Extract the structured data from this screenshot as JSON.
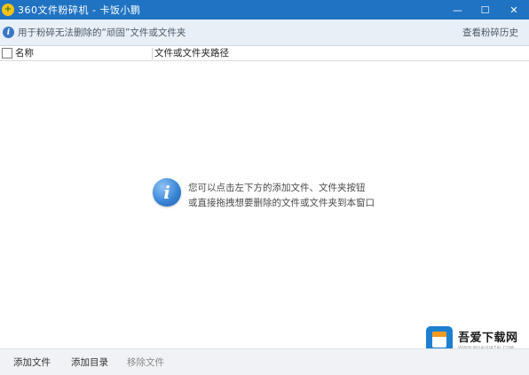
{
  "window": {
    "title": "360文件粉碎机 - 卡饭小鹏",
    "controls": {
      "minimize": "—",
      "maximize": "☐",
      "close": "✕"
    }
  },
  "infobar": {
    "message": "用于粉碎无法删除的“顽固”文件或文件夹",
    "history_link": "查看粉碎历史"
  },
  "columns": {
    "name": "名称",
    "path": "文件或文件夹路径"
  },
  "hint": {
    "line1": "您可以点击左下方的添加文件、文件夹按钮",
    "line2": "或直接拖拽想要删除的文件或文件夹到本窗口"
  },
  "footer": {
    "add_file": "添加文件",
    "add_dir": "添加目录",
    "remove_file": "移除文件"
  },
  "watermark": {
    "main": "吾爱下载网",
    "sub": "WWW.WUAIXIAZAI.COM"
  },
  "colors": {
    "titlebar": "#1f73c2",
    "infobar_bg": "#e9eff6",
    "footer_bg": "#f0f2f5"
  }
}
